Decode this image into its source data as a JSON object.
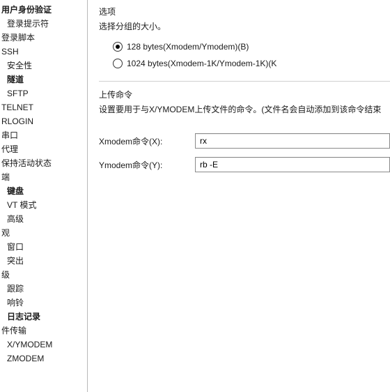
{
  "sidebar": {
    "items": [
      {
        "label": "用户身份验证",
        "depth": 0,
        "bold": true
      },
      {
        "label": "登录提示符",
        "depth": 1,
        "bold": false
      },
      {
        "label": "登录脚本",
        "depth": 0,
        "bold": false
      },
      {
        "label": "SSH",
        "depth": 0,
        "bold": false
      },
      {
        "label": "安全性",
        "depth": 1,
        "bold": false
      },
      {
        "label": "隧道",
        "depth": 1,
        "bold": true
      },
      {
        "label": "SFTP",
        "depth": 1,
        "bold": false
      },
      {
        "label": "TELNET",
        "depth": 0,
        "bold": false
      },
      {
        "label": "RLOGIN",
        "depth": 0,
        "bold": false
      },
      {
        "label": "串口",
        "depth": 0,
        "bold": false
      },
      {
        "label": "代理",
        "depth": 0,
        "bold": false
      },
      {
        "label": "保持活动状态",
        "depth": 0,
        "bold": false
      },
      {
        "label": "端",
        "depth": 0,
        "bold": false
      },
      {
        "label": "键盘",
        "depth": 1,
        "bold": true
      },
      {
        "label": "VT 模式",
        "depth": 1,
        "bold": false
      },
      {
        "label": "高级",
        "depth": 1,
        "bold": false
      },
      {
        "label": "观",
        "depth": 0,
        "bold": false
      },
      {
        "label": "窗口",
        "depth": 1,
        "bold": false
      },
      {
        "label": "突出",
        "depth": 1,
        "bold": false
      },
      {
        "label": "级",
        "depth": 0,
        "bold": false
      },
      {
        "label": "跟踪",
        "depth": 1,
        "bold": false
      },
      {
        "label": "响铃",
        "depth": 1,
        "bold": false
      },
      {
        "label": "日志记录",
        "depth": 1,
        "bold": true
      },
      {
        "label": "件传输",
        "depth": 0,
        "bold": false
      },
      {
        "label": "X/YMODEM",
        "depth": 1,
        "bold": false
      },
      {
        "label": "ZMODEM",
        "depth": 1,
        "bold": false
      }
    ]
  },
  "options": {
    "title": "选项",
    "desc": "选择分组的大小。",
    "radios": [
      {
        "label": "128 bytes(Xmodem/Ymodem)(B)",
        "checked": true
      },
      {
        "label": "1024 bytes(Xmodem-1K/Ymodem-1K)(K",
        "checked": false
      }
    ]
  },
  "upload": {
    "title": "上传命令",
    "desc": "设置要用于与X/YMODEM上传文件的命令。(文件名会自动添加到该命令结束",
    "xmodem_label": "Xmodem命令(X):",
    "xmodem_value": "rx",
    "ymodem_label": "Ymodem命令(Y):",
    "ymodem_value": "rb -E"
  }
}
